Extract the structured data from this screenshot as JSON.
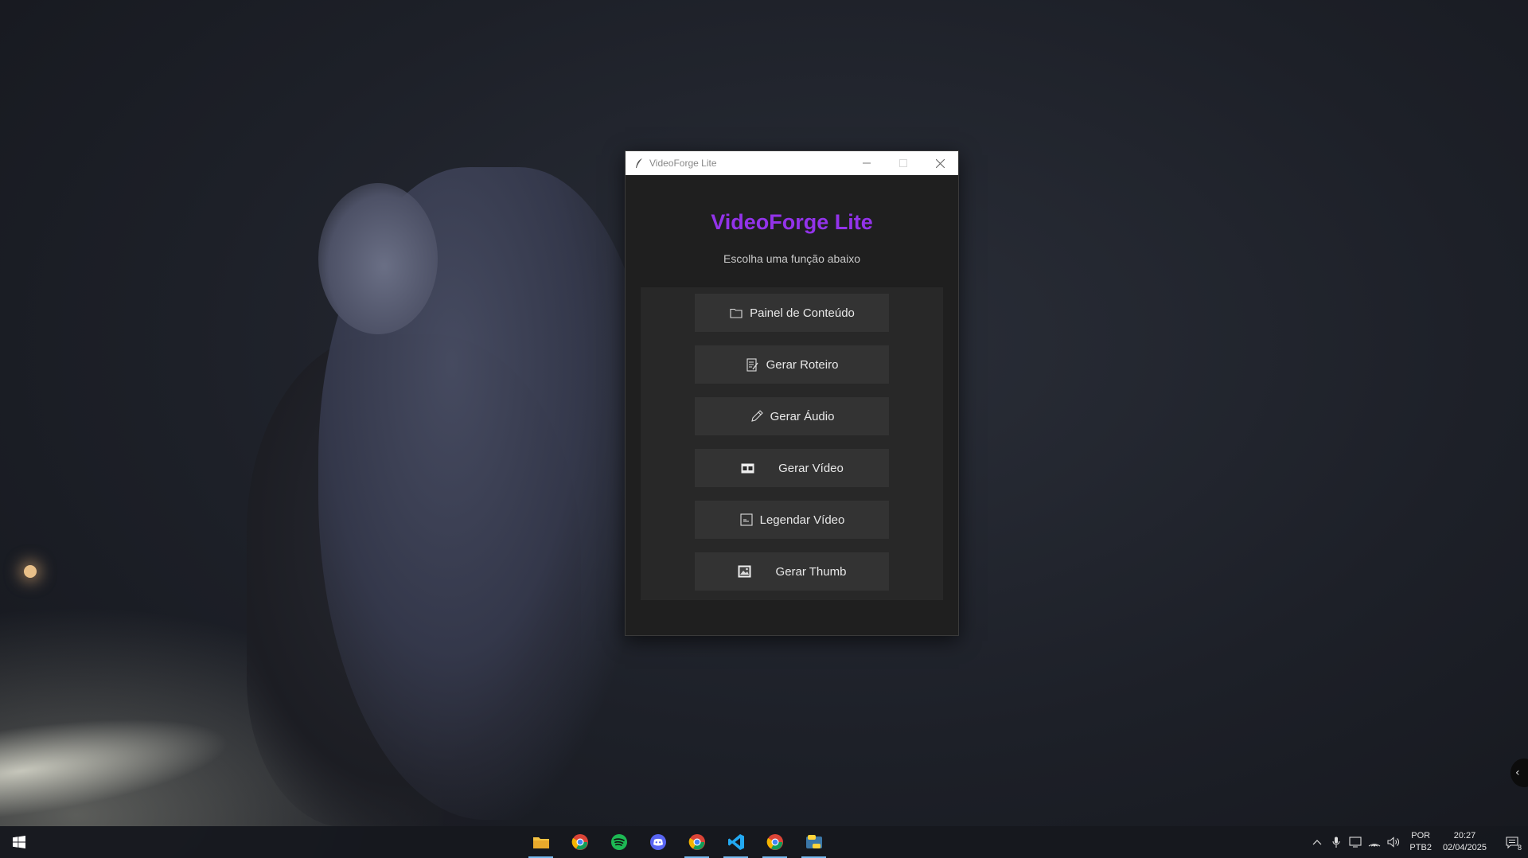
{
  "window": {
    "title": "VideoForge Lite",
    "minimize_icon": "minimize-icon",
    "maximize_icon": "maximize-icon",
    "close_icon": "close-icon"
  },
  "app": {
    "heading": "VideoForge Lite",
    "subtitle": "Escolha uma função abaixo",
    "accent_color": "#9333ea",
    "buttons": [
      {
        "label": "Painel de Conteúdo",
        "icon": "folder-icon"
      },
      {
        "label": "Gerar Roteiro",
        "icon": "script-icon"
      },
      {
        "label": "Gerar Áudio",
        "icon": "pencil-icon"
      },
      {
        "label": "Gerar Vídeo",
        "icon": "video-icon"
      },
      {
        "label": "Legendar Vídeo",
        "icon": "caption-icon"
      },
      {
        "label": "Gerar Thumb",
        "icon": "image-icon"
      }
    ]
  },
  "taskbar": {
    "apps": [
      {
        "name": "File Explorer",
        "icon": "folder-icon",
        "active": true
      },
      {
        "name": "Chrome",
        "icon": "chrome-icon",
        "active": false
      },
      {
        "name": "Spotify",
        "icon": "spotify-icon",
        "active": false
      },
      {
        "name": "Discord",
        "icon": "discord-icon",
        "active": false
      },
      {
        "name": "Chrome",
        "icon": "chrome-icon",
        "active": true
      },
      {
        "name": "Visual Studio Code",
        "icon": "vscode-icon",
        "active": true
      },
      {
        "name": "Chrome",
        "icon": "chrome-icon",
        "active": true
      },
      {
        "name": "Python",
        "icon": "python-icon",
        "active": true
      }
    ],
    "language": "POR",
    "layout": "PTB2",
    "time": "20:27",
    "date": "02/04/2025",
    "notification_count": "8"
  }
}
